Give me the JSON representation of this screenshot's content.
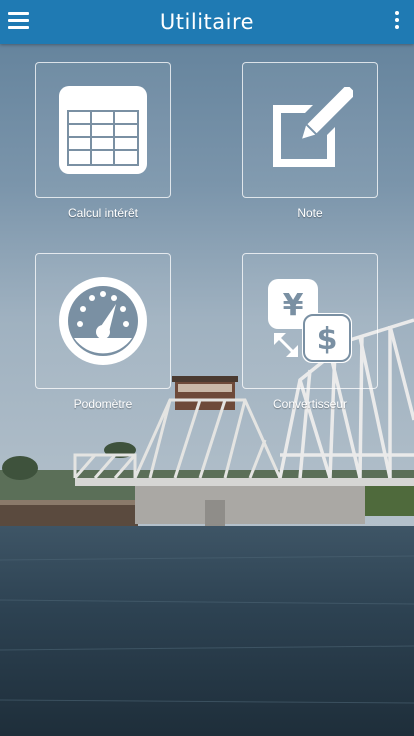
{
  "appbar": {
    "title": "Utilitaire",
    "menu_icon": "hamburger-menu-icon",
    "more_icon": "more-vertical-icon",
    "color": "#1f7ab3"
  },
  "tiles": [
    {
      "label": "Calcul intérêt",
      "icon": "table-grid-icon"
    },
    {
      "label": "Note",
      "icon": "note-edit-icon"
    },
    {
      "label": "Podomètre",
      "icon": "speedometer-gauge-icon"
    },
    {
      "label": "Convertisseur",
      "icon": "currency-exchange-icon"
    }
  ]
}
